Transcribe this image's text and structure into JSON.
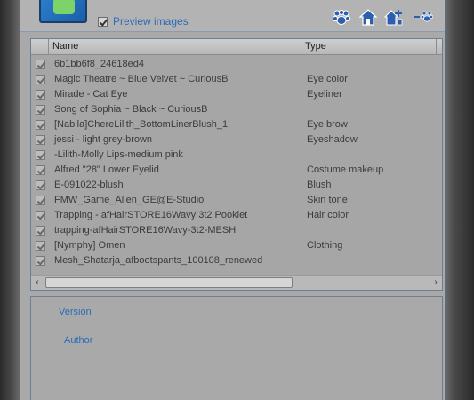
{
  "toolbar": {
    "preview_label": "Preview images",
    "preview_checked": true,
    "icons": [
      "paw-icon",
      "house-icon",
      "house-plus-icon",
      "minus-paw-icon"
    ]
  },
  "columns": {
    "name": "Name",
    "type": "Type"
  },
  "items": [
    {
      "name": "6b1bb6f8_24618ed4",
      "type": ""
    },
    {
      "name": "Magic Theatre ~ Blue Velvet ~ CuriousB",
      "type": "Eye color"
    },
    {
      "name": "Mirade - Cat Eye",
      "type": "Eyeliner"
    },
    {
      "name": "Song of Sophia ~ Black ~ CuriousB",
      "type": ""
    },
    {
      "name": "[Nabila]ChereLilith_BottomLinerBlush_1",
      "type": "Eye brow"
    },
    {
      "name": "jessi - light grey-brown",
      "type": "Eyeshadow"
    },
    {
      "name": "-Lilith-Molly Lips-medium pink",
      "type": ""
    },
    {
      "name": "Alfred \"28\" Lower Eyelid",
      "type": "Costume makeup"
    },
    {
      "name": "E-091022-blush",
      "type": "Blush"
    },
    {
      "name": "FMW_Game_Alien_GE@E-Studio",
      "type": "Skin tone"
    },
    {
      "name": "Trapping - afHairSTORE16Wavy 3t2 Pooklet",
      "type": "Hair color"
    },
    {
      "name": "trapping-afHairSTORE16Wavy-3t2-MESH",
      "type": ""
    },
    {
      "name": "[Nymphy] Omen",
      "type": "Clothing"
    },
    {
      "name": "Mesh_Shatarja_afbootspants_100108_renewed",
      "type": ""
    }
  ],
  "info": {
    "version_label": "Version",
    "author_label": "Author"
  },
  "colors": {
    "link": "#2b6cb8",
    "panel": "#a9a9a9",
    "border": "#6f7f92"
  }
}
